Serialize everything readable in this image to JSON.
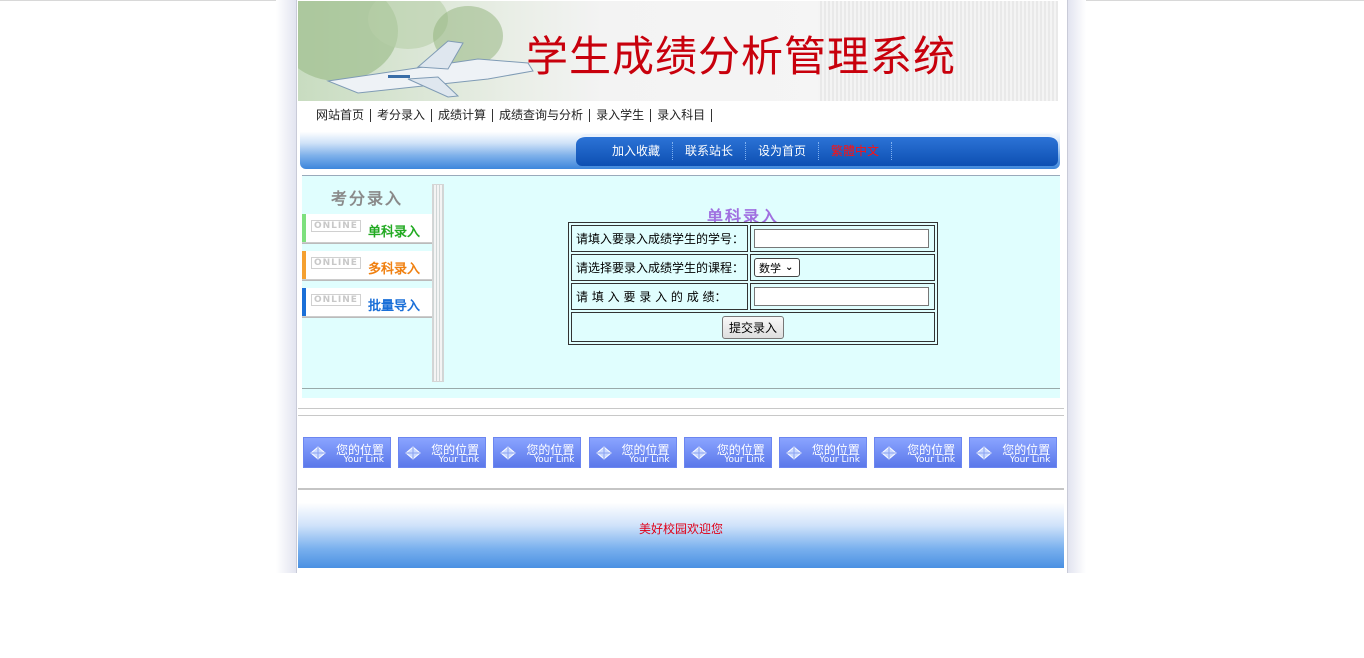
{
  "header": {
    "title": "学生成绩分析管理系统"
  },
  "topnav": {
    "items": [
      "网站首页",
      "考分录入",
      "成绩计算",
      "成绩查询与分析",
      "录入学生",
      "录入科目"
    ]
  },
  "subnav": {
    "items": [
      "加入收藏",
      "联系站长",
      "设为首页",
      "繁體中文"
    ]
  },
  "sidebar": {
    "heading": "考分录入",
    "badge": "ONLINE",
    "items": [
      {
        "label": "单科录入",
        "color": "#22aa22"
      },
      {
        "label": "多科录入",
        "color": "#f08010"
      },
      {
        "label": "批量导入",
        "color": "#1a6fd8"
      }
    ]
  },
  "form": {
    "title": "单科录入",
    "student_id_label": "请填入要录入成绩学生的学号：",
    "student_id_value": "",
    "course_label": "请选择要录入成绩学生的课程：",
    "course_selected": "数学",
    "score_label": "请 填 入 要 录 入 的 成 绩：",
    "score_value": "",
    "submit_label": "提交录入"
  },
  "link_buttons": [
    {
      "title": "您的位置",
      "subtitle": "Your Link"
    },
    {
      "title": "您的位置",
      "subtitle": "Your Link"
    },
    {
      "title": "您的位置",
      "subtitle": "Your Link"
    },
    {
      "title": "您的位置",
      "subtitle": "Your Link"
    },
    {
      "title": "您的位置",
      "subtitle": "Your Link"
    },
    {
      "title": "您的位置",
      "subtitle": "Your Link"
    },
    {
      "title": "您的位置",
      "subtitle": "Your Link"
    },
    {
      "title": "您的位置",
      "subtitle": "Your Link"
    }
  ],
  "footer": {
    "message": "美好校园欢迎您"
  },
  "colors": {
    "title_red": "#c8000c",
    "nav_blue": "#0d4fb2",
    "content_bg": "#e0fefe",
    "link_blue": "#5b78ea"
  }
}
